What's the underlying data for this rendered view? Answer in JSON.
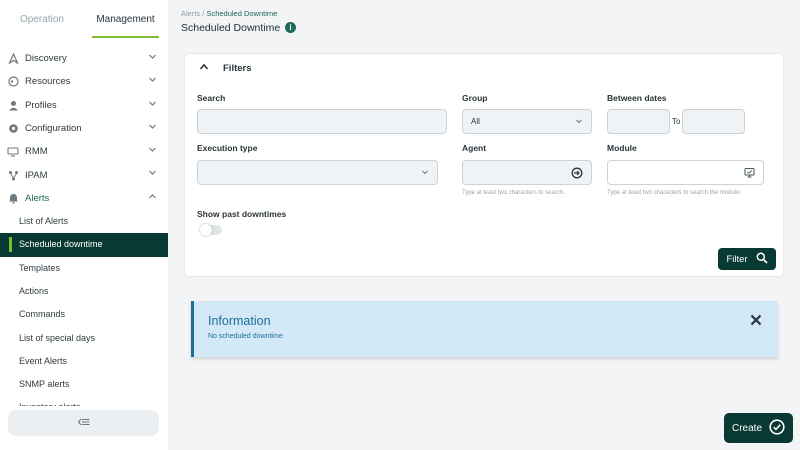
{
  "tabs": {
    "operation": "Operation",
    "management": "Management"
  },
  "nav": {
    "groups": [
      {
        "label": "Discovery",
        "icon": "discovery-icon"
      },
      {
        "label": "Resources",
        "icon": "resources-icon"
      },
      {
        "label": "Profiles",
        "icon": "profiles-icon"
      },
      {
        "label": "Configuration",
        "icon": "gear-icon"
      },
      {
        "label": "RMM",
        "icon": "rmm-icon"
      },
      {
        "label": "IPAM",
        "icon": "ipam-icon"
      },
      {
        "label": "Alerts",
        "icon": "bell-icon"
      }
    ],
    "alerts_sub": [
      {
        "label": "List of Alerts"
      },
      {
        "label": "Scheduled downtime"
      },
      {
        "label": "Templates"
      },
      {
        "label": "Actions"
      },
      {
        "label": "Commands"
      },
      {
        "label": "List of special days"
      },
      {
        "label": "Event Alerts"
      },
      {
        "label": "SNMP alerts"
      },
      {
        "label": "Inventory alerts"
      }
    ]
  },
  "header": {
    "breadcrumb_root": "Alerts",
    "breadcrumb_sep": " / ",
    "breadcrumb_current": "Scheduled Downtime",
    "title": "Scheduled Downtime"
  },
  "filters": {
    "title": "Filters",
    "search_label": "Search",
    "search_value": "",
    "group_label": "Group",
    "group_value": "All",
    "between_dates_label": "Between dates",
    "to_label": "To",
    "execution_type_label": "Execution type",
    "execution_type_value": "",
    "agent_label": "Agent",
    "agent_hint": "Type at least two characters to search.",
    "module_label": "Module",
    "module_hint": "Type at least two characters to search the module.",
    "show_past_label": "Show past downtimes",
    "show_past_on": false,
    "filter_button": "Filter"
  },
  "info": {
    "title": "Information",
    "message": "No scheduled downtime"
  },
  "create_button": "Create",
  "colors": {
    "accent_dark": "#083932",
    "accent_green": "#82b92e",
    "info_blue": "#1f6e9a",
    "info_bg": "#d3e9f7"
  }
}
